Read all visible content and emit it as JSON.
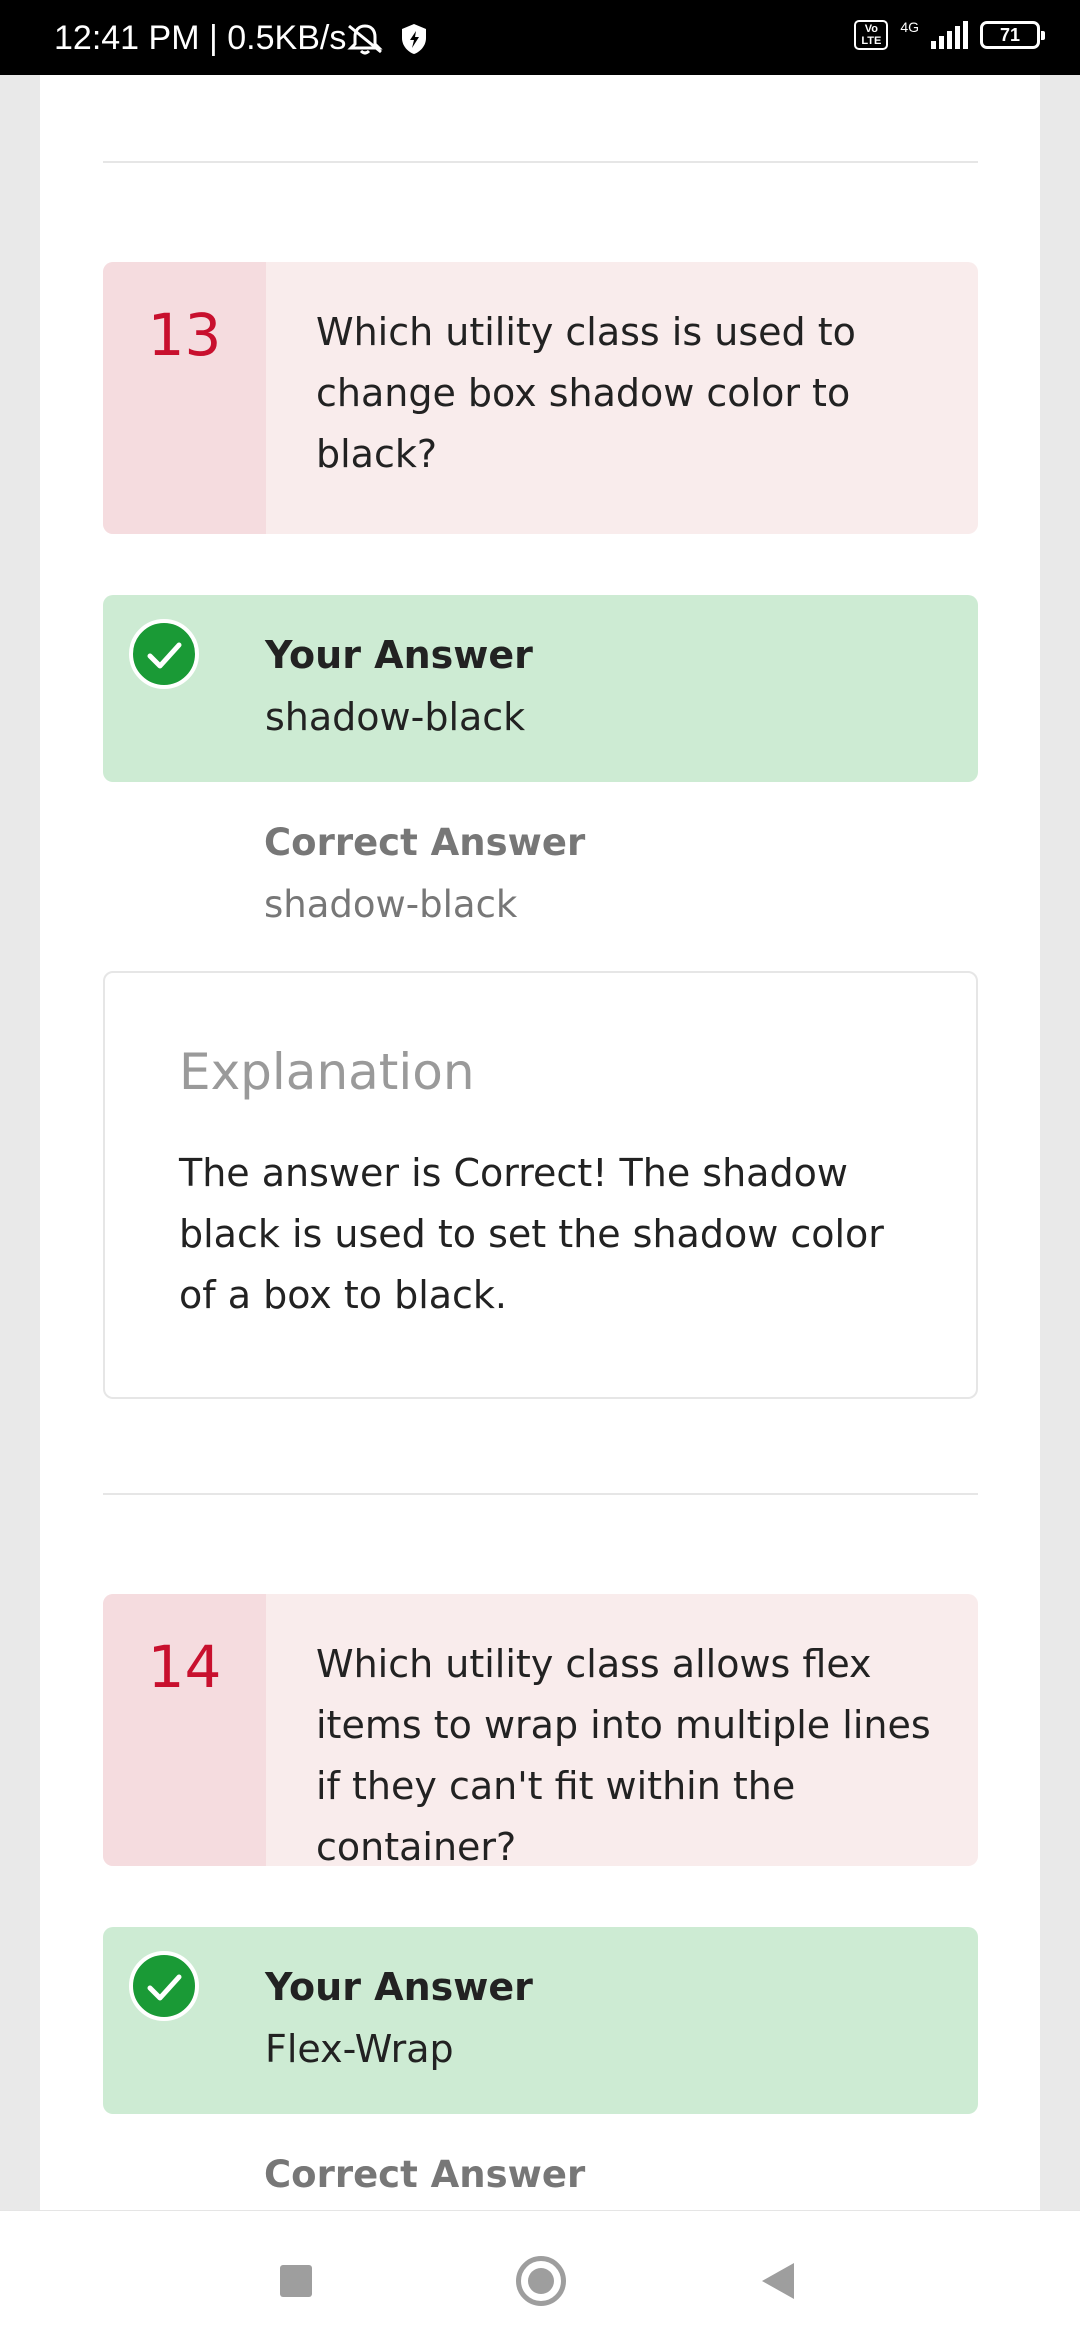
{
  "status_bar": {
    "time": "12:41 PM | 0.5KB/s",
    "volte": "Vo\nLTE",
    "network": "4G",
    "battery": "71"
  },
  "questions": [
    {
      "number": "13",
      "question": "Which utility class is used to change box shadow color to black?",
      "your_answer_label": "Your Answer",
      "your_answer": "shadow-black",
      "correct_answer_label": "Correct Answer",
      "correct_answer": "shadow-black",
      "explanation_title": "Explanation",
      "explanation": "The answer is Correct! The shadow black is used to set the shadow color of a box to black."
    },
    {
      "number": "14",
      "question": "Which utility class allows flex items to wrap into multiple lines if they can't fit within the container?",
      "your_answer_label": "Your Answer",
      "your_answer": "Flex-Wrap",
      "correct_answer_label": "Correct Answer"
    }
  ],
  "colors": {
    "question_number": "#c8102e",
    "answer_bg": "#cdebd3",
    "check": "#1a9a36",
    "question_bg": "#f9ecec"
  }
}
